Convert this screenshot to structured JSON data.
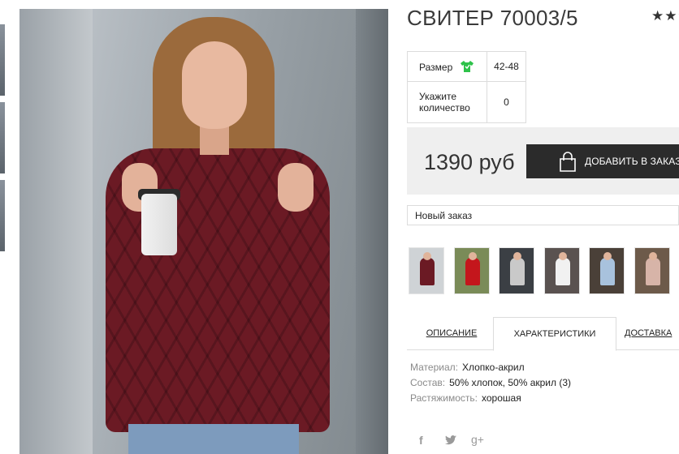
{
  "product": {
    "title": "СВИТЕР 70003/5",
    "rating_stars": "★★★",
    "main_photo_icon": "product-photo-woman-in-burgundy-sweater"
  },
  "params": {
    "size_label": "Размер",
    "size_value": "42-48",
    "qty_label": "Укажите количество",
    "qty_value": "0"
  },
  "purchase": {
    "price": "1390 руб",
    "add_to_cart_label": "ДОБАВИТЬ В ЗАКАЗ",
    "order_select_value": "Новый заказ"
  },
  "gallery": [
    {
      "name": "gallery-thumb-1",
      "bg": "#cfd3d6",
      "color": "#6b1a24"
    },
    {
      "name": "gallery-thumb-2",
      "bg": "#7a8b58",
      "color": "#c4161c"
    },
    {
      "name": "gallery-thumb-3",
      "bg": "#3b3f44",
      "color": "#c9c9c9"
    },
    {
      "name": "gallery-thumb-4",
      "bg": "#5a5250",
      "color": "#f1f1f1"
    },
    {
      "name": "gallery-thumb-5",
      "bg": "#4a4038",
      "color": "#a8c2dd"
    },
    {
      "name": "gallery-thumb-6",
      "bg": "#6d5a4a",
      "color": "#d7b4a8"
    }
  ],
  "tabs": {
    "description": "ОПИСАНИЕ",
    "characteristics": "ХАРАКТЕРИСТИКИ",
    "delivery": "ДОСТАВКА"
  },
  "specs": {
    "material_label": "Материал:",
    "material_value": "Хлопко-акрил",
    "composition_label": "Состав:",
    "composition_value": "50% хлопок, 50% акрил (3)",
    "stretch_label": "Растяжимость:",
    "stretch_value": "хорошая"
  },
  "social": {
    "facebook": "f",
    "twitter": "twitter-bird",
    "googleplus": "g+"
  },
  "colors": {
    "price_box_bg": "#efefef",
    "button_bg": "#2b2b2b",
    "size_icon": "#2ec24a"
  }
}
